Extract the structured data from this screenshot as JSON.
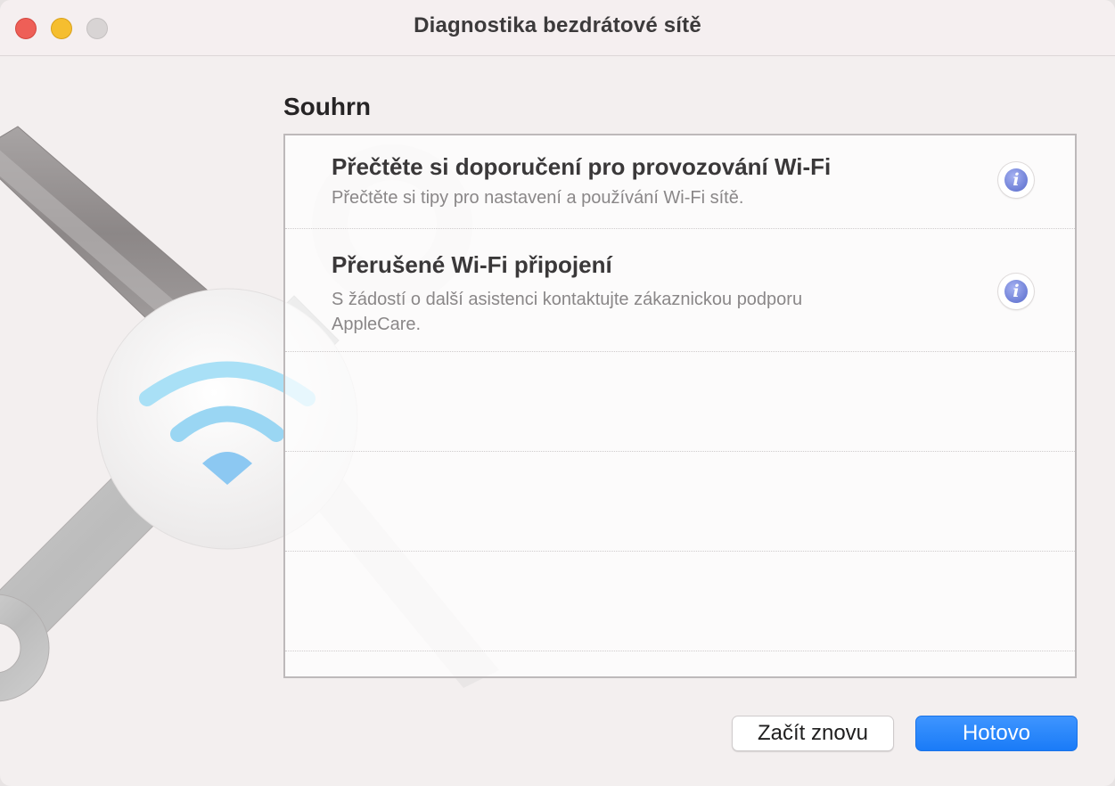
{
  "window": {
    "title": "Diagnostika bezdrátové sítě"
  },
  "summary": {
    "heading": "Souhrn",
    "items": [
      {
        "title": "Přečtěte si doporučení pro provozování Wi-Fi",
        "subtitle": "Přečtěte si tipy pro nastavení a používání Wi-Fi sítě.",
        "icon": "info-icon"
      },
      {
        "title": "Přerušené Wi-Fi připojení",
        "subtitle": "S žádostí o další asistenci kontaktujte zákaznickou podporu AppleCare.",
        "icon": "info-icon"
      }
    ]
  },
  "buttons": {
    "restart_label": "Začít znovu",
    "done_label": "Hotovo"
  },
  "colors": {
    "accent": "#1a7bf7",
    "wifi": "#8fd3f5",
    "close": "#ee5f57",
    "minimize": "#f5be2f"
  }
}
